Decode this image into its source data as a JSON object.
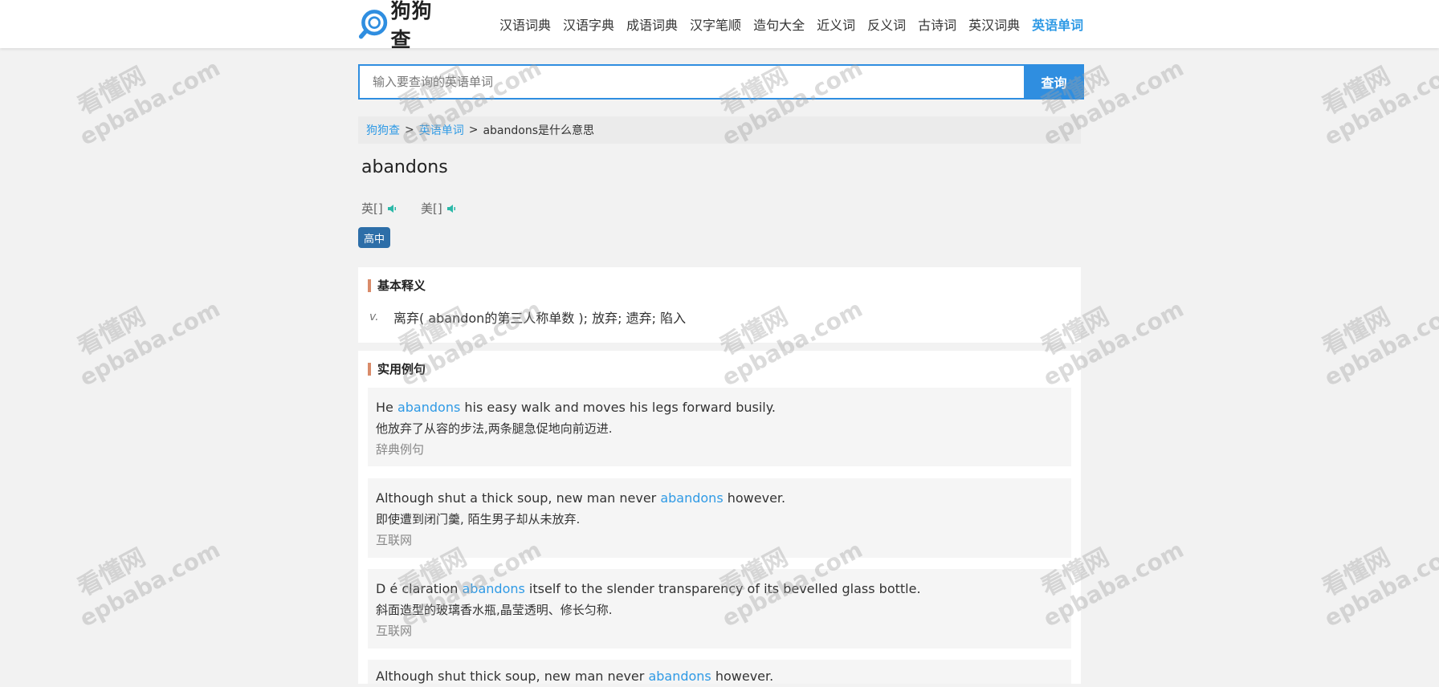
{
  "site": {
    "logo_text": "狗狗查"
  },
  "nav": {
    "items": [
      "汉语词典",
      "汉语字典",
      "成语词典",
      "汉字笔顺",
      "造句大全",
      "近义词",
      "反义词",
      "古诗词",
      "英汉词典",
      "英语单词"
    ],
    "active_index": 9
  },
  "search": {
    "placeholder": "输入要查询的英语单词",
    "value": "",
    "button_label": "查询"
  },
  "breadcrumb": {
    "home": "狗狗查",
    "sep1": ">",
    "section": "英语单词",
    "sep2": ">",
    "current": "abandons是什么意思"
  },
  "word": {
    "title": "abandons",
    "phonetic_uk_label": "英[]",
    "phonetic_us_label": "美[]",
    "level_badge": "高中"
  },
  "basic_definition": {
    "heading": "基本释义",
    "pos": "v.",
    "text": "离弃( abandon的第三人称单数 ); 放弃; 遗弃; 陷入"
  },
  "examples": {
    "heading": "实用例句",
    "items": [
      {
        "en_before": "He ",
        "en_hl": "abandons",
        "en_after": " his easy walk and moves his legs forward busily.",
        "zh": "他放弃了从容的步法,两条腿急促地向前迈进.",
        "source": "辞典例句"
      },
      {
        "en_before": "Although shut a thick soup, new man never ",
        "en_hl": "abandons",
        "en_after": " however.",
        "zh": "即使遭到闭门羹, 陌生男子却从未放弃.",
        "source": "互联网"
      },
      {
        "en_before": "D é claration ",
        "en_hl": "abandons",
        "en_after": " itself to the slender transparency of its bevelled glass bottle.",
        "zh": "斜面造型的玻璃香水瓶,晶莹透明、修长匀称.",
        "source": "互联网"
      },
      {
        "en_before": "Although shut thick soup, new man never ",
        "en_hl": "abandons",
        "en_after": " however.",
        "zh": "",
        "source": ""
      }
    ]
  },
  "watermark": {
    "cn": "看懂网",
    "en": "epbaba.com"
  },
  "colors": {
    "accent": "#2f8ee0",
    "link": "#2f9ae5",
    "badge": "#2d6ea8",
    "speaker": "#2bb8a8",
    "heading_bar": "#d98b6a"
  }
}
